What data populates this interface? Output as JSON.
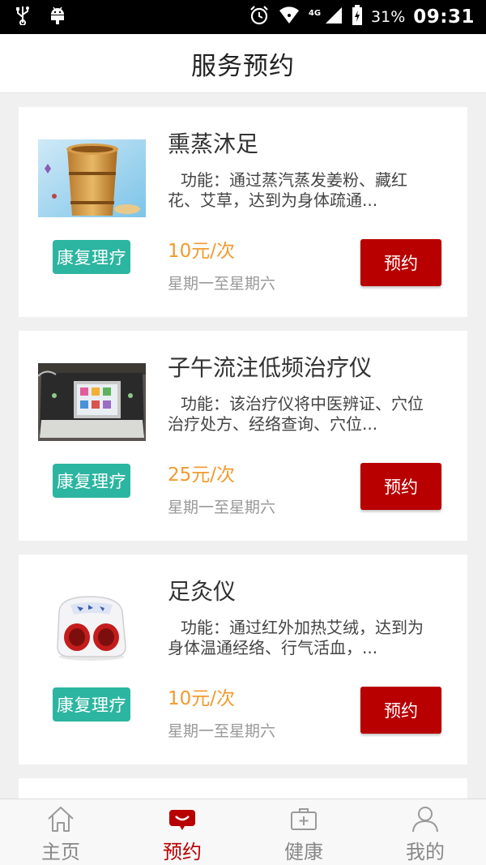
{
  "status_bar": {
    "network": "4G",
    "battery": "31%",
    "time": "09:31"
  },
  "header": {
    "title": "服务预约"
  },
  "services": [
    {
      "title": "熏蒸沐足",
      "description": "功能：通过蒸汽蒸发姜粉、藏红花、艾草，达到为身体疏通...",
      "tag": "康复理疗",
      "price": "10元/次",
      "schedule": "星期一至星期六",
      "button": "预约",
      "image_icon": "wooden-foot-bath-image"
    },
    {
      "title": "子午流注低频治疗仪",
      "description": "功能：该治疗仪将中医辨证、穴位治疗处方、经络查询、穴位...",
      "tag": "康复理疗",
      "price": "25元/次",
      "schedule": "星期一至星期六",
      "button": "预约",
      "image_icon": "therapy-device-image"
    },
    {
      "title": "足灸仪",
      "description": "功能：通过红外加热艾绒，达到为身体温通经络、行气活血，...",
      "tag": "康复理疗",
      "price": "10元/次",
      "schedule": "星期一至星期六",
      "button": "预约",
      "image_icon": "foot-moxibustion-device-image"
    }
  ],
  "bottom_nav": [
    {
      "label": "主页",
      "icon": "home-icon",
      "active": false
    },
    {
      "label": "预约",
      "icon": "chat-bubble-icon",
      "active": true
    },
    {
      "label": "健康",
      "icon": "medical-kit-icon",
      "active": false
    },
    {
      "label": "我的",
      "icon": "person-icon",
      "active": false
    }
  ],
  "colors": {
    "accent_red": "#b80000",
    "tag_teal": "#2cb5a0",
    "price_orange": "#f29a2e"
  }
}
